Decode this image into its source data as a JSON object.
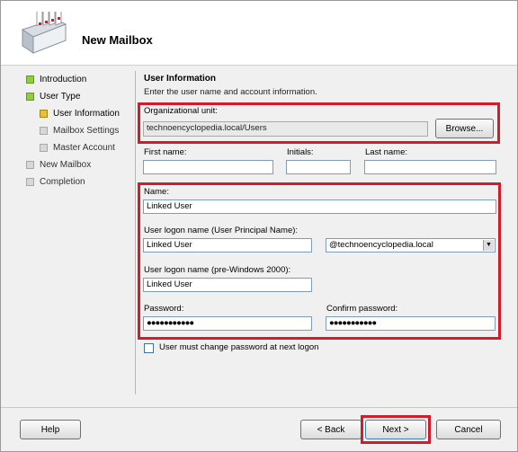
{
  "header": {
    "title": "New Mailbox",
    "icon": "mailbox-wizard-icon"
  },
  "nav": {
    "items": [
      {
        "label": "Introduction",
        "state": "completed"
      },
      {
        "label": "User Type",
        "state": "completed"
      },
      {
        "label": "User Information",
        "state": "current"
      },
      {
        "label": "Mailbox Settings",
        "state": "pending"
      },
      {
        "label": "Master Account",
        "state": "pending"
      },
      {
        "label": "New Mailbox",
        "state": "pending"
      },
      {
        "label": "Completion",
        "state": "pending"
      }
    ]
  },
  "section": {
    "title": "User Information",
    "description": "Enter the user name and account information."
  },
  "org_unit": {
    "label": "Organizational unit:",
    "value": "technoencyclopedia.local/Users",
    "browse_label": "Browse..."
  },
  "first_name": {
    "label": "First name:",
    "value": ""
  },
  "initials": {
    "label": "Initials:",
    "value": ""
  },
  "last_name": {
    "label": "Last name:",
    "value": ""
  },
  "name": {
    "label": "Name:",
    "value": "Linked User"
  },
  "upn": {
    "label": "User logon name (User Principal Name):",
    "value": "Linked User",
    "domain": "@technoencyclopedia.local"
  },
  "pre2000": {
    "label": "User logon name (pre-Windows 2000):",
    "value": "Linked User"
  },
  "password": {
    "label": "Password:",
    "value": "●●●●●●●●●●●"
  },
  "confirm_password": {
    "label": "Confirm password:",
    "value": "●●●●●●●●●●●"
  },
  "must_change": {
    "label": "User must change password at next logon",
    "checked": false
  },
  "buttons": {
    "help": "Help",
    "back": "< Back",
    "next": "Next >",
    "cancel": "Cancel"
  },
  "colors": {
    "highlight": "#d11c2a",
    "completed": "#8fcf3c",
    "current": "#e3c23a"
  }
}
